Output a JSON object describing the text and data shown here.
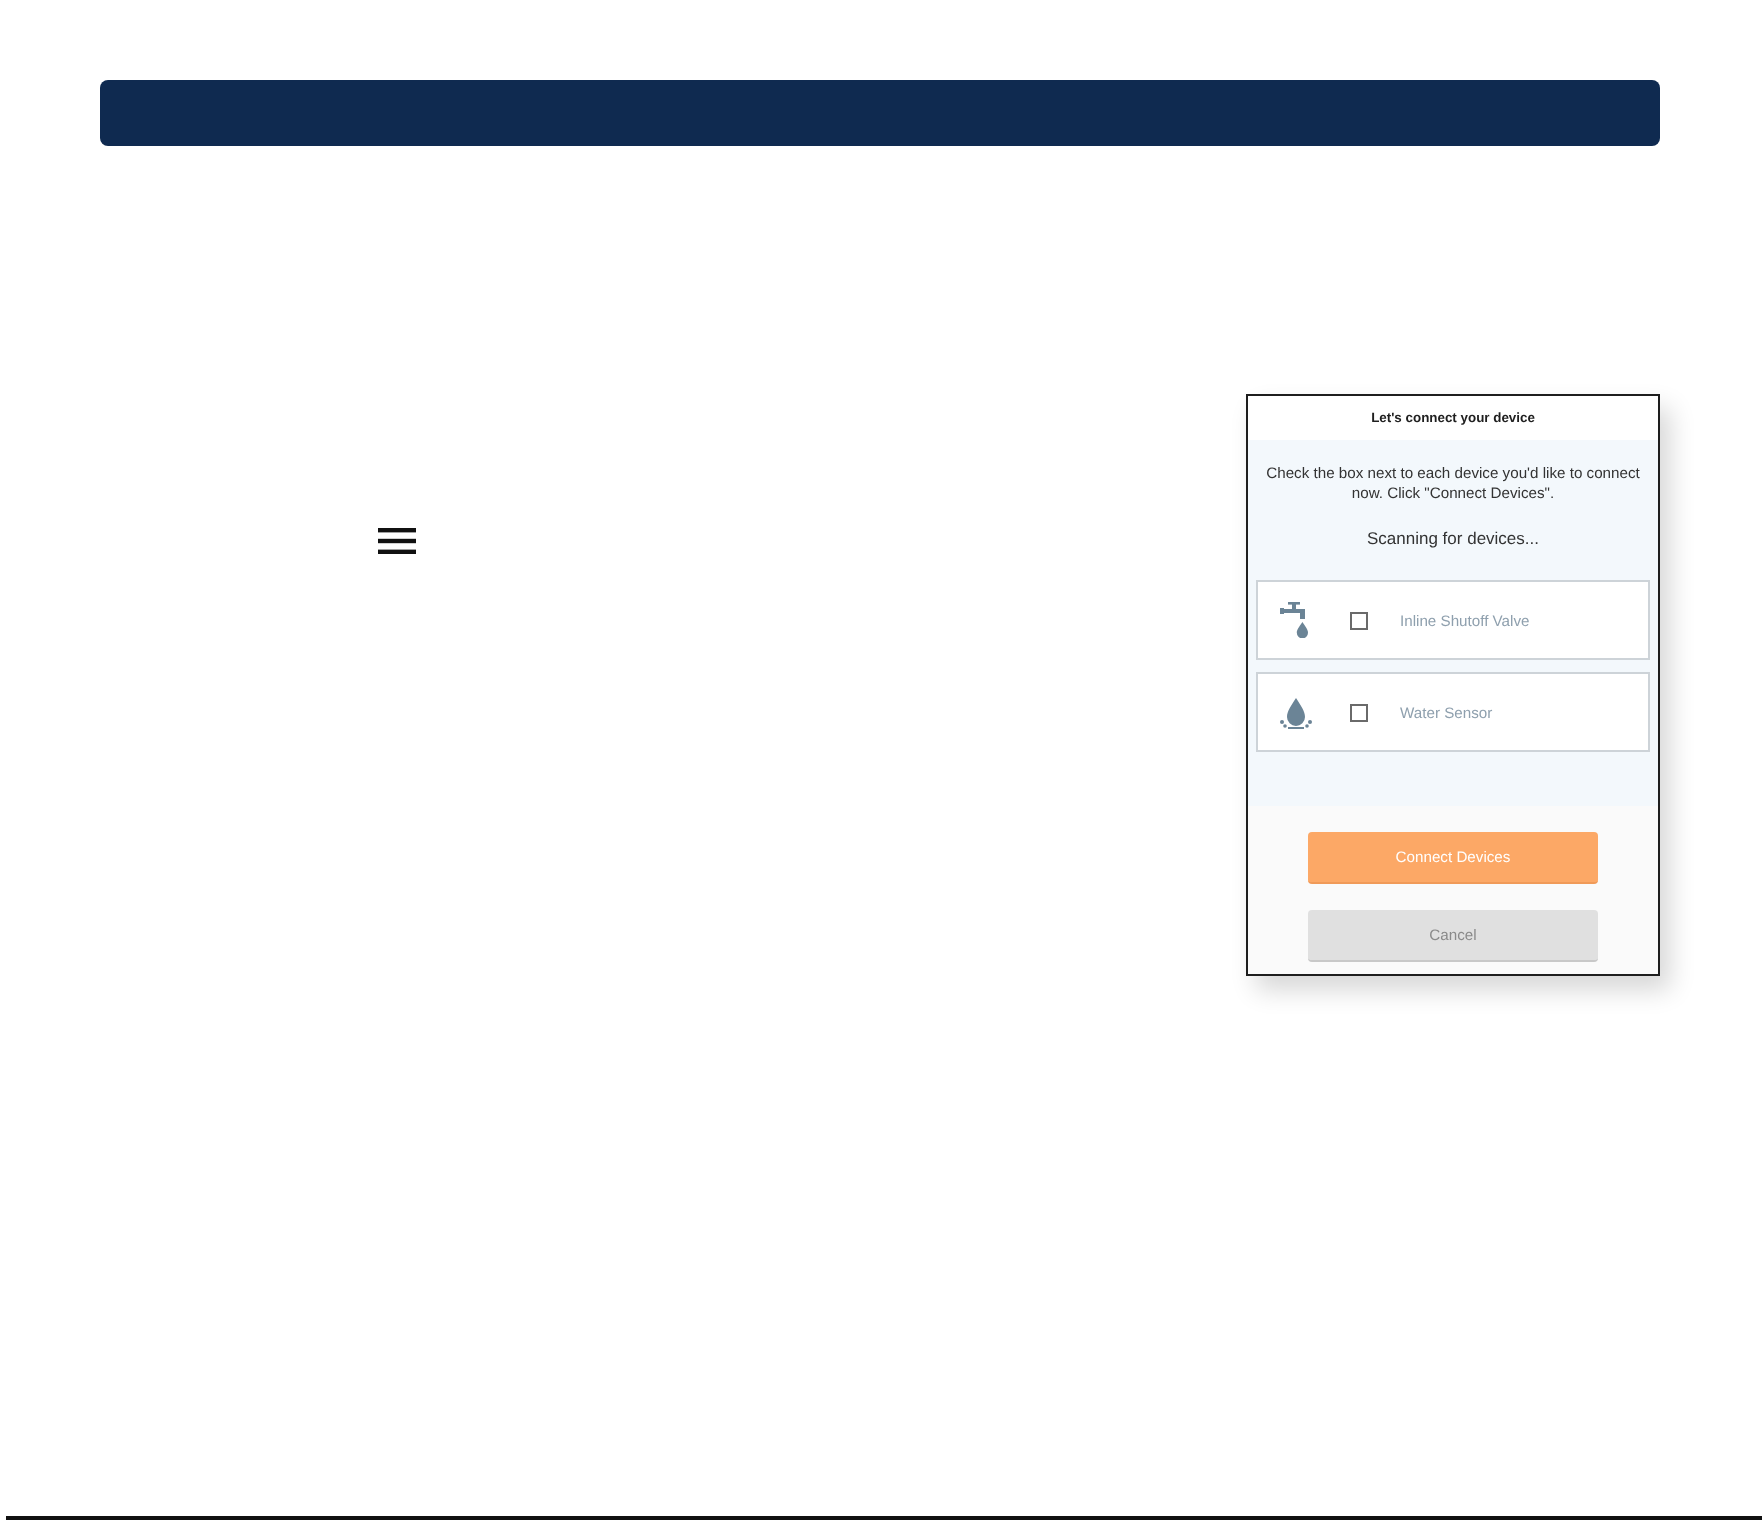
{
  "screenshot": {
    "title": "Let's connect your device",
    "instructions": "Check the box next to each device you'd like to connect now. Click \"Connect Devices\".",
    "status": "Scanning for devices...",
    "devices": [
      {
        "kind": "valve",
        "name": "Inline Shutoff Valve",
        "checked": false
      },
      {
        "kind": "sensor",
        "name": "Water Sensor",
        "checked": false
      }
    ],
    "buttons": [
      {
        "kind": "primary",
        "label": "Connect Devices"
      },
      {
        "kind": "secondary",
        "label": "Cancel"
      }
    ]
  }
}
